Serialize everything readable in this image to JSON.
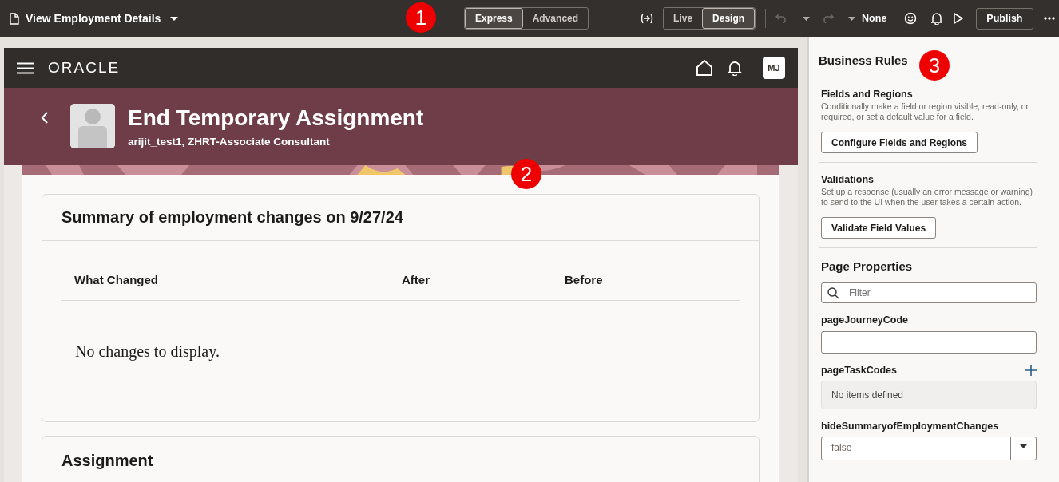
{
  "toolbar": {
    "page_title": "View Employment Details",
    "mode_toggle": [
      {
        "label": "Express",
        "selected": true
      },
      {
        "label": "Advanced",
        "selected": false
      }
    ],
    "view_toggle": [
      {
        "label": "Live",
        "selected": false
      },
      {
        "label": "Design",
        "selected": true
      }
    ],
    "undo_disabled": true,
    "redo_disabled": true,
    "theme": "None",
    "publish": "Publish"
  },
  "app_header": {
    "logo": "ORACLE",
    "avatar_initials": "MJ"
  },
  "page_header": {
    "title": "End Temporary Assignment",
    "subtitle": "arijit_test1, ZHRT-Associate Consultant"
  },
  "summary": {
    "title": "Summary of employment changes on 9/27/24",
    "columns": [
      "What Changed",
      "After",
      "Before"
    ],
    "empty_message": "No changes to display."
  },
  "assignment": {
    "title": "Assignment"
  },
  "business_rules": {
    "title": "Business Rules",
    "sections": [
      {
        "title": "Fields and Regions",
        "description": "Conditionally make a field or region visible, read-only, or required, or set a default value for a field.",
        "button": "Configure Fields and Regions"
      },
      {
        "title": "Validations",
        "description": "Set up a response (usually an error message or warning) to send to the UI when the user takes a certain action.",
        "button": "Validate Field Values"
      }
    ]
  },
  "page_properties": {
    "title": "Page Properties",
    "filter": {
      "placeholder": "Filter"
    },
    "properties": [
      {
        "kind": "text",
        "name": "pageJourneyCode"
      },
      {
        "kind": "list",
        "name": "pageTaskCodes",
        "empty_text": "No items defined"
      },
      {
        "kind": "select",
        "name": "hideSummaryofEmploymentChanges",
        "value": "false"
      }
    ]
  },
  "callouts": [
    "1",
    "2",
    "3"
  ]
}
